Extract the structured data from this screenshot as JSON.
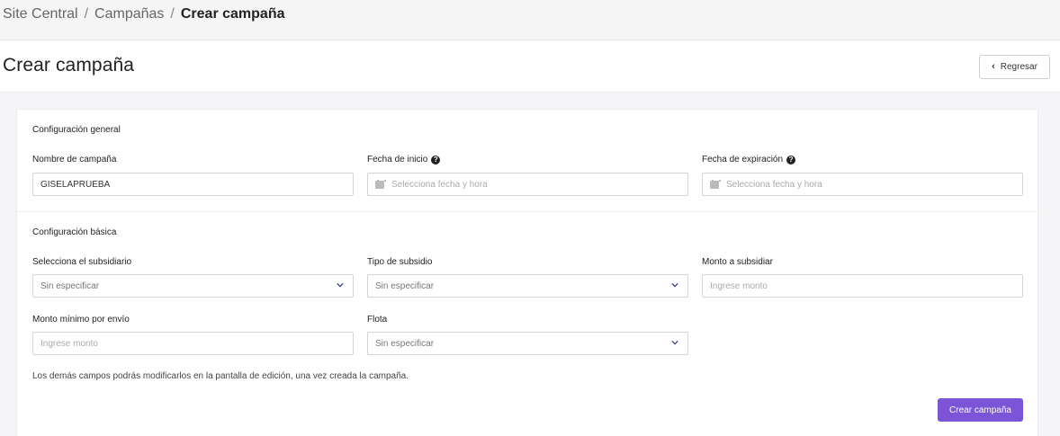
{
  "breadcrumb": {
    "items": [
      "Site Central",
      "Campañas"
    ],
    "current": "Crear campaña",
    "separator": "/"
  },
  "header": {
    "title": "Crear campaña",
    "back_label": "Regresar"
  },
  "general": {
    "title": "Configuración general",
    "campaign_name": {
      "label": "Nombre de campaña",
      "value": "GISELAPRUEBA"
    },
    "start_date": {
      "label": "Fecha de inicio",
      "placeholder": "Selecciona fecha y hora"
    },
    "end_date": {
      "label": "Fecha de expiración",
      "placeholder": "Selecciona fecha y hora"
    }
  },
  "basic": {
    "title": "Configuración básica",
    "subsidiary": {
      "label": "Selecciona el subsidiario",
      "value": "Sin especificar"
    },
    "subsidy_type": {
      "label": "Tipo de subsidio",
      "value": "Sin especificar"
    },
    "subsidy_amount": {
      "label": "Monto a subsidiar",
      "placeholder": "Ingrese monto"
    },
    "min_amount": {
      "label": "Monto mínimo por envío",
      "placeholder": "Ingrese monto"
    },
    "fleet": {
      "label": "Flota",
      "value": "Sin especificar"
    }
  },
  "note": "Los demás campos podrás modificarlos en la pantalla de edición, una vez creada la campaña.",
  "submit_label": "Crear campaña",
  "colors": {
    "accent": "#7b55d6",
    "chevron": "#2b3a8c"
  },
  "icons": {
    "help": "question-circle-icon",
    "calendar": "calendar-icon",
    "select": "chevron-down-icon",
    "back": "chevron-left-icon"
  }
}
